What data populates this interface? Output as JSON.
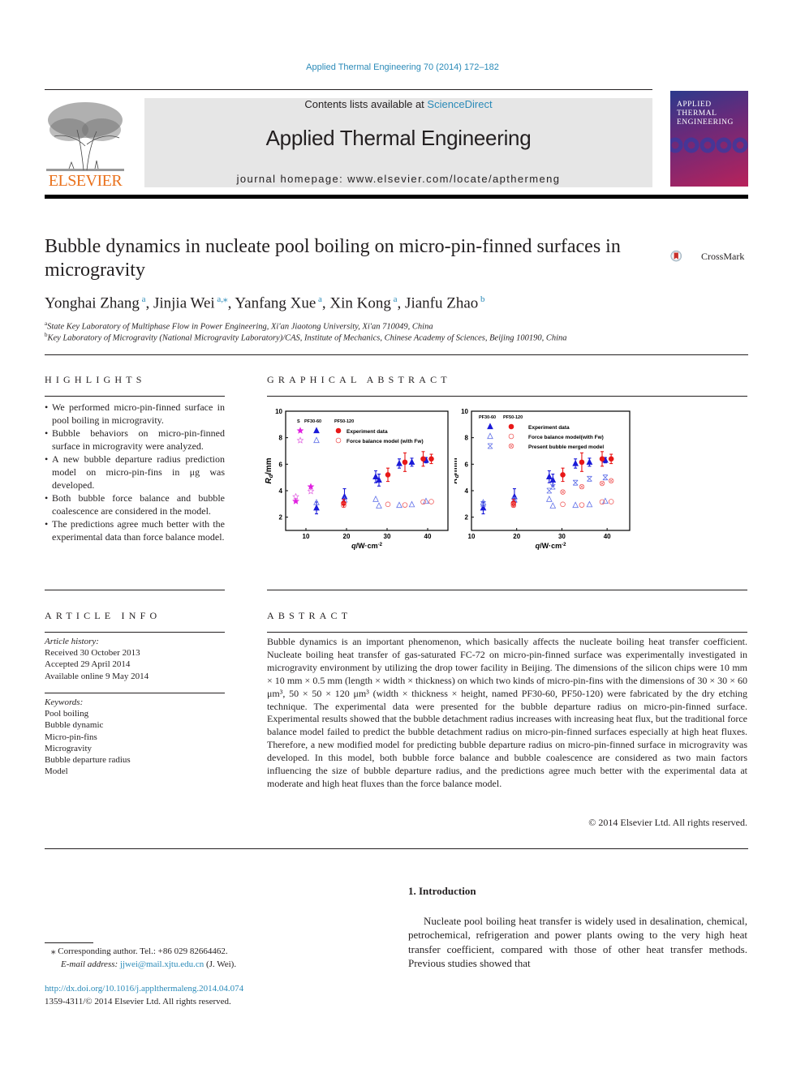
{
  "citation": "Applied Thermal Engineering 70 (2014) 172–182",
  "header": {
    "contents_prefix": "Contents lists available at ",
    "contents_link": "ScienceDirect",
    "journal_name": "Applied Thermal Engineering",
    "homepage": "journal homepage: www.elsevier.com/locate/apthermeng",
    "publisher_logo_text": "ELSEVIER",
    "cover_title": [
      "APPLIED",
      "THERMAL",
      "ENGINEERING"
    ]
  },
  "crossmark_label": "CrossMark",
  "article": {
    "title": "Bubble dynamics in nucleate pool boiling on micro-pin-finned surfaces in microgravity",
    "authors": [
      {
        "name": "Yonghai Zhang",
        "sup": "a"
      },
      {
        "name": "Jinjia Wei",
        "sup": "a,⁎"
      },
      {
        "name": "Yanfang Xue",
        "sup": "a"
      },
      {
        "name": "Xin Kong",
        "sup": "a"
      },
      {
        "name": "Jianfu Zhao",
        "sup": "b"
      }
    ],
    "affiliations": [
      {
        "sup": "a",
        "text": "State Key Laboratory of Multiphase Flow in Power Engineering, Xi'an Jiaotong University, Xi'an 710049, China"
      },
      {
        "sup": "b",
        "text": "Key Laboratory of Microgravity (National Microgravity Laboratory)/CAS, Institute of Mechanics, Chinese Academy of Sciences, Beijing 100190, China"
      }
    ]
  },
  "highlights": {
    "heading": "HIGHLIGHTS",
    "items": [
      "We performed micro-pin-finned surface in pool boiling in microgravity.",
      "Bubble behaviors on micro-pin-finned surface in microgravity were analyzed.",
      "A new bubble departure radius prediction model on micro-pin-fins in μg was developed.",
      "Both bubble force balance and bubble coalescence are considered in the model.",
      "The predictions agree much better with the experimental data than force balance model."
    ]
  },
  "graphical_abstract": {
    "heading": "GRAPHICAL ABSTRACT"
  },
  "article_info": {
    "heading": "ARTICLE INFO",
    "history_label": "Article history:",
    "history": [
      "Received 30 October 2013",
      "Accepted 29 April 2014",
      "Available online 9 May 2014"
    ],
    "keywords_label": "Keywords:",
    "keywords": [
      "Pool boiling",
      "Bubble dynamic",
      "Micro-pin-fins",
      "Microgravity",
      "Bubble departure radius",
      "Model"
    ]
  },
  "abstract": {
    "heading": "ABSTRACT",
    "text": "Bubble dynamics is an important phenomenon, which basically affects the nucleate boiling heat transfer coefficient. Nucleate boiling heat transfer of gas-saturated FC-72 on micro-pin-finned surface was experimentally investigated in microgravity environment by utilizing the drop tower facility in Beijing. The dimensions of the silicon chips were 10 mm × 10 mm × 0.5 mm (length × width × thickness) on which two kinds of micro-pin-fins with the dimensions of 30 × 30 × 60 μm³, 50 × 50 × 120 μm³ (width × thickness × height, named PF30-60, PF50-120) were fabricated by the dry etching technique. The experimental data were presented for the bubble departure radius on micro-pin-finned surface. Experimental results showed that the bubble detachment radius increases with increasing heat flux, but the traditional force balance model failed to predict the bubble detachment radius on micro-pin-finned surfaces especially at high heat fluxes. Therefore, a new modified model for predicting bubble departure radius on micro-pin-finned surface in microgravity was developed. In this model, both bubble force balance and bubble coalescence are considered as two main factors influencing the size of bubble departure radius, and the predictions agree much better with the experimental data at moderate and high heat fluxes than the force balance model.",
    "copyright": "© 2014 Elsevier Ltd. All rights reserved."
  },
  "introduction": {
    "heading": "1.  Introduction",
    "text": "Nucleate pool boiling heat transfer is widely used in desalination, chemical, petrochemical, refrigeration and power plants owing to the very high heat transfer coefficient, compared with those of other heat transfer methods. Previous studies showed that"
  },
  "footnote": {
    "corresponding": "⁎  Corresponding author. Tel.: +86 029 82664462.",
    "email_label": "E-mail address: ",
    "email": "jjwei@mail.xjtu.edu.cn",
    "email_suffix": " (J. Wei).",
    "doi": "http://dx.doi.org/10.1016/j.applthermaleng.2014.04.074",
    "issn": "1359-4311/© 2014 Elsevier Ltd. All rights reserved."
  },
  "chart_data": [
    {
      "type": "scatter",
      "title": "",
      "xlabel": "q/W·cm⁻²",
      "ylabel": "Rd/mm",
      "xlim": [
        5,
        45
      ],
      "ylim": [
        1,
        10
      ],
      "xticks": [
        10,
        20,
        30,
        40
      ],
      "yticks": [
        2,
        4,
        6,
        8,
        10
      ],
      "grid": false,
      "legend_position": "top-left",
      "legend_columns": [
        "S",
        "PF30-60",
        "PF50-120"
      ],
      "legend_rows": [
        "Experiment data",
        "Force balance model (with Fw)"
      ],
      "series": [
        {
          "name": "S Experiment data",
          "marker": "star-filled",
          "color": "#e020e0",
          "points": [
            [
              7.5,
              3.2
            ],
            [
              11.2,
              4.3
            ]
          ]
        },
        {
          "name": "S Force balance model",
          "marker": "star-open",
          "color": "#e060e0",
          "points": [
            [
              7.5,
              3.55
            ],
            [
              11.2,
              3.95
            ]
          ]
        },
        {
          "name": "PF30-60 Experiment data",
          "marker": "triangle-filled",
          "color": "#1a1ad8",
          "points": [
            [
              12.6,
              2.7,
              0.45
            ],
            [
              19.5,
              3.55,
              0.6
            ],
            [
              27.2,
              5.05,
              0.45
            ],
            [
              28.0,
              4.8,
              0.45
            ],
            [
              33.0,
              6.05,
              0.35
            ],
            [
              36.1,
              6.15,
              0.3
            ],
            [
              39.6,
              6.3,
              0.2
            ]
          ]
        },
        {
          "name": "PF30-60 Force balance model",
          "marker": "triangle-open",
          "color": "#6070e8",
          "points": [
            [
              12.6,
              3.1
            ],
            [
              19.5,
              3.3
            ],
            [
              27.2,
              3.35
            ],
            [
              28.0,
              2.85
            ],
            [
              33.0,
              2.9
            ],
            [
              36.1,
              2.95
            ],
            [
              39.6,
              3.2
            ]
          ]
        },
        {
          "name": "PF50-120 Experiment data",
          "marker": "circle-filled",
          "color": "#e81818",
          "points": [
            [
              19.3,
              3.05,
              0.3
            ],
            [
              30.2,
              5.2,
              0.5
            ],
            [
              34.4,
              6.15,
              0.7
            ],
            [
              38.9,
              6.4,
              0.55
            ],
            [
              40.9,
              6.4,
              0.35
            ]
          ]
        },
        {
          "name": "PF50-120 Force balance model",
          "marker": "circle-open",
          "color": "#f06060",
          "points": [
            [
              19.3,
              2.9
            ],
            [
              30.2,
              2.97
            ],
            [
              34.4,
              2.92
            ],
            [
              38.9,
              3.15
            ],
            [
              40.9,
              3.17
            ]
          ]
        }
      ]
    },
    {
      "type": "scatter",
      "title": "",
      "xlabel": "q/W·cm⁻²",
      "ylabel": "Rd/mm",
      "xlim": [
        10,
        45
      ],
      "ylim": [
        1,
        10
      ],
      "xticks": [
        10,
        20,
        30,
        40
      ],
      "yticks": [
        2,
        4,
        6,
        8,
        10
      ],
      "grid": false,
      "legend_position": "top-left",
      "legend_columns": [
        "PF30-60",
        "PF50-120"
      ],
      "legend_rows": [
        "Experiment data",
        "Force balance model(with Fw)",
        "Present bubble merged model"
      ],
      "series": [
        {
          "name": "PF30-60 Experiment data",
          "marker": "triangle-filled",
          "color": "#1a1ad8",
          "points": [
            [
              12.6,
              2.7,
              0.45
            ],
            [
              19.5,
              3.55,
              0.6
            ],
            [
              27.2,
              5.05,
              0.45
            ],
            [
              28.0,
              4.8,
              0.45
            ],
            [
              33.0,
              6.05,
              0.35
            ],
            [
              36.1,
              6.15,
              0.3
            ],
            [
              39.6,
              6.3,
              0.2
            ]
          ]
        },
        {
          "name": "PF30-60 Force balance model",
          "marker": "triangle-open",
          "color": "#6070e8",
          "points": [
            [
              12.6,
              3.1
            ],
            [
              19.5,
              3.3
            ],
            [
              27.2,
              3.35
            ],
            [
              28.0,
              2.85
            ],
            [
              33.0,
              2.9
            ],
            [
              36.1,
              2.95
            ],
            [
              39.6,
              3.2
            ]
          ]
        },
        {
          "name": "PF30-60 Present bubble merged model",
          "marker": "cross-box",
          "color": "#6070e8",
          "points": [
            [
              12.6,
              3.0
            ],
            [
              19.5,
              3.3
            ],
            [
              27.2,
              4.0
            ],
            [
              28.0,
              4.3
            ],
            [
              33.0,
              4.6
            ],
            [
              36.1,
              4.9
            ],
            [
              39.6,
              5.0
            ]
          ]
        },
        {
          "name": "PF50-120 Experiment data",
          "marker": "circle-filled",
          "color": "#e81818",
          "points": [
            [
              19.3,
              3.05,
              0.3
            ],
            [
              30.2,
              5.2,
              0.5
            ],
            [
              34.4,
              6.15,
              0.7
            ],
            [
              38.9,
              6.4,
              0.55
            ],
            [
              40.9,
              6.4,
              0.35
            ]
          ]
        },
        {
          "name": "PF50-120 Force balance model",
          "marker": "circle-open",
          "color": "#f06060",
          "points": [
            [
              19.3,
              2.9
            ],
            [
              30.2,
              2.97
            ],
            [
              34.4,
              2.92
            ],
            [
              38.9,
              3.15
            ],
            [
              40.9,
              3.17
            ]
          ]
        },
        {
          "name": "PF50-120 Present bubble merged model",
          "marker": "circle-cross",
          "color": "#f06060",
          "points": [
            [
              19.3,
              2.95
            ],
            [
              30.2,
              3.9
            ],
            [
              34.4,
              4.3
            ],
            [
              38.9,
              4.55
            ],
            [
              40.9,
              4.75
            ]
          ]
        }
      ]
    }
  ]
}
